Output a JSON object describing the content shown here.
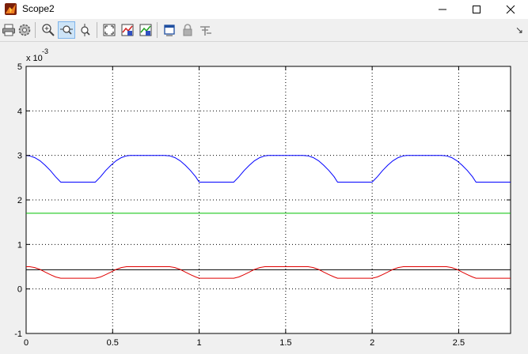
{
  "window": {
    "title": "Scope2",
    "minimize_glyph": "—",
    "maximize_glyph": "☐",
    "close_glyph": "✕"
  },
  "toolbar": {
    "buttons": [
      {
        "icon": "print-icon"
      },
      {
        "icon": "parameters-icon"
      },
      {
        "icon": "zoom-in-icon"
      },
      {
        "icon": "zoom-x-axis-icon",
        "active": true
      },
      {
        "icon": "zoom-y-axis-icon"
      },
      {
        "icon": "autoscale-icon"
      },
      {
        "icon": "save-axes-settings-icon"
      },
      {
        "icon": "restore-axes-settings-icon"
      },
      {
        "icon": "floating-scope-icon"
      },
      {
        "icon": "lock-axes-icon"
      },
      {
        "icon": "signal-selection-icon"
      }
    ],
    "overflow_glyph": "↘"
  },
  "chart_data": {
    "type": "line",
    "xlim": [
      0,
      2.8
    ],
    "ylim": [
      -1,
      5
    ],
    "y_exponent_label": "x 10",
    "y_exponent": "-3",
    "xticks": [
      0,
      0.5,
      1,
      1.5,
      2,
      2.5
    ],
    "xtick_labels": [
      "0",
      "0.5",
      "1",
      "1.5",
      "2",
      "2.5"
    ],
    "yticks": [
      -1,
      0,
      1,
      2,
      3,
      4,
      5
    ],
    "ytick_labels": [
      "-1",
      "0",
      "1",
      "2",
      "3",
      "4",
      "5"
    ],
    "grid": true,
    "series": [
      {
        "color": "#0000ff",
        "x": [
          0,
          0.02,
          0.05,
          0.08,
          0.11,
          0.14,
          0.17,
          0.2,
          0.4,
          0.43,
          0.46,
          0.49,
          0.52,
          0.55,
          0.58,
          0.6,
          0.8,
          0.83,
          0.86,
          0.89,
          0.92,
          0.95,
          0.98,
          1.0,
          1.2,
          1.23,
          1.26,
          1.29,
          1.32,
          1.35,
          1.38,
          1.4,
          1.6,
          1.63,
          1.66,
          1.69,
          1.72,
          1.75,
          1.78,
          1.8,
          2.0,
          2.03,
          2.06,
          2.09,
          2.12,
          2.15,
          2.18,
          2.2,
          2.4,
          2.43,
          2.46,
          2.49,
          2.52,
          2.55,
          2.58,
          2.6,
          2.8
        ],
        "y": [
          3.0,
          2.99,
          2.95,
          2.88,
          2.78,
          2.66,
          2.52,
          2.4,
          2.4,
          2.52,
          2.66,
          2.78,
          2.88,
          2.95,
          2.99,
          3.0,
          3.0,
          2.99,
          2.95,
          2.88,
          2.78,
          2.66,
          2.52,
          2.4,
          2.4,
          2.52,
          2.66,
          2.78,
          2.88,
          2.95,
          2.99,
          3.0,
          3.0,
          2.99,
          2.95,
          2.88,
          2.78,
          2.66,
          2.52,
          2.4,
          2.4,
          2.52,
          2.66,
          2.78,
          2.88,
          2.95,
          2.99,
          3.0,
          3.0,
          2.99,
          2.95,
          2.88,
          2.78,
          2.66,
          2.52,
          2.4,
          2.4
        ]
      },
      {
        "color": "#00c000",
        "x": [
          0,
          2.8
        ],
        "y": [
          1.7,
          1.7
        ]
      },
      {
        "color": "#000000",
        "x": [
          0,
          2.8
        ],
        "y": [
          0.43,
          0.43
        ]
      },
      {
        "color": "#e00000",
        "x": [
          0,
          0.02,
          0.05,
          0.08,
          0.11,
          0.14,
          0.17,
          0.2,
          0.4,
          0.43,
          0.46,
          0.49,
          0.52,
          0.55,
          0.58,
          0.6,
          0.8,
          0.83,
          0.86,
          0.89,
          0.92,
          0.95,
          0.98,
          1.0,
          1.2,
          1.23,
          1.26,
          1.29,
          1.32,
          1.35,
          1.38,
          1.4,
          1.6,
          1.63,
          1.66,
          1.69,
          1.72,
          1.75,
          1.78,
          1.8,
          2.0,
          2.03,
          2.06,
          2.09,
          2.12,
          2.15,
          2.18,
          2.2,
          2.4,
          2.43,
          2.46,
          2.49,
          2.52,
          2.55,
          2.58,
          2.6,
          2.8
        ],
        "y": [
          0.5,
          0.5,
          0.48,
          0.44,
          0.38,
          0.32,
          0.27,
          0.24,
          0.24,
          0.27,
          0.32,
          0.38,
          0.44,
          0.48,
          0.5,
          0.5,
          0.5,
          0.5,
          0.48,
          0.44,
          0.38,
          0.32,
          0.27,
          0.24,
          0.24,
          0.27,
          0.32,
          0.38,
          0.44,
          0.48,
          0.5,
          0.5,
          0.5,
          0.5,
          0.48,
          0.44,
          0.38,
          0.32,
          0.27,
          0.24,
          0.24,
          0.27,
          0.32,
          0.38,
          0.44,
          0.48,
          0.5,
          0.5,
          0.5,
          0.5,
          0.48,
          0.44,
          0.38,
          0.32,
          0.27,
          0.24,
          0.24
        ]
      }
    ]
  }
}
